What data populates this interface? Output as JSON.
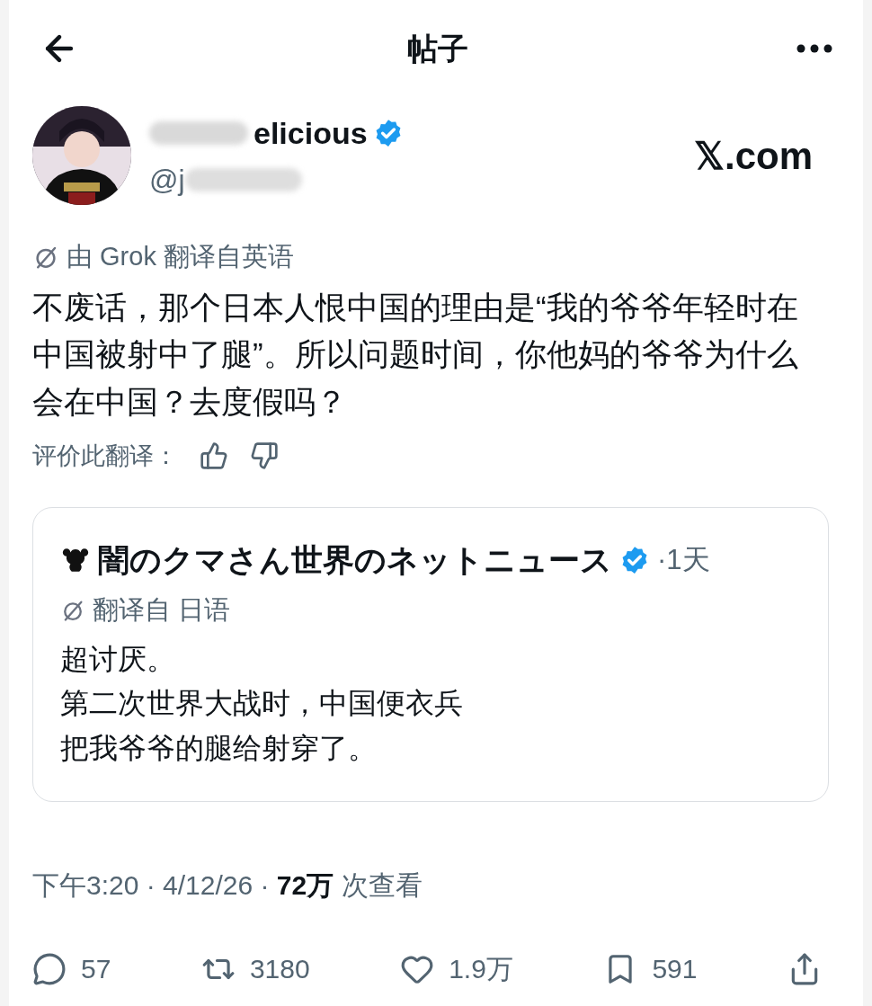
{
  "header": {
    "title": "帖子"
  },
  "author": {
    "name_visible": "elicious",
    "handle_visible": "@j",
    "verified": true
  },
  "site_label": "𝕏.com",
  "translation_note": "由 Grok 翻译自英语",
  "post_text": "不废话，那个日本人恨中国的理由是“我的爷爷年轻时在中国被射中了腿”。所以问题时间，你他妈的爷爷为什么会在中国？去度假吗？",
  "rate_label": "评价此翻译：",
  "quote": {
    "author": "闇のクマさん世界のネットニュース",
    "verified": true,
    "time": "·1天",
    "translation_note": "翻译自 日语",
    "lines": [
      "超讨厌。",
      "第二次世界大战时，中国便衣兵",
      "把我爷爷的腿给射穿了。"
    ]
  },
  "meta": {
    "time": "下午3:20 · 4/12/26 · ",
    "views": "72万",
    "views_label": " 次查看"
  },
  "actions": [
    {
      "kind": "reply",
      "count": "57"
    },
    {
      "kind": "repost",
      "count": "3180"
    },
    {
      "kind": "like",
      "count": "1.9万"
    },
    {
      "kind": "bookmark",
      "count": "591"
    },
    {
      "kind": "share"
    }
  ]
}
